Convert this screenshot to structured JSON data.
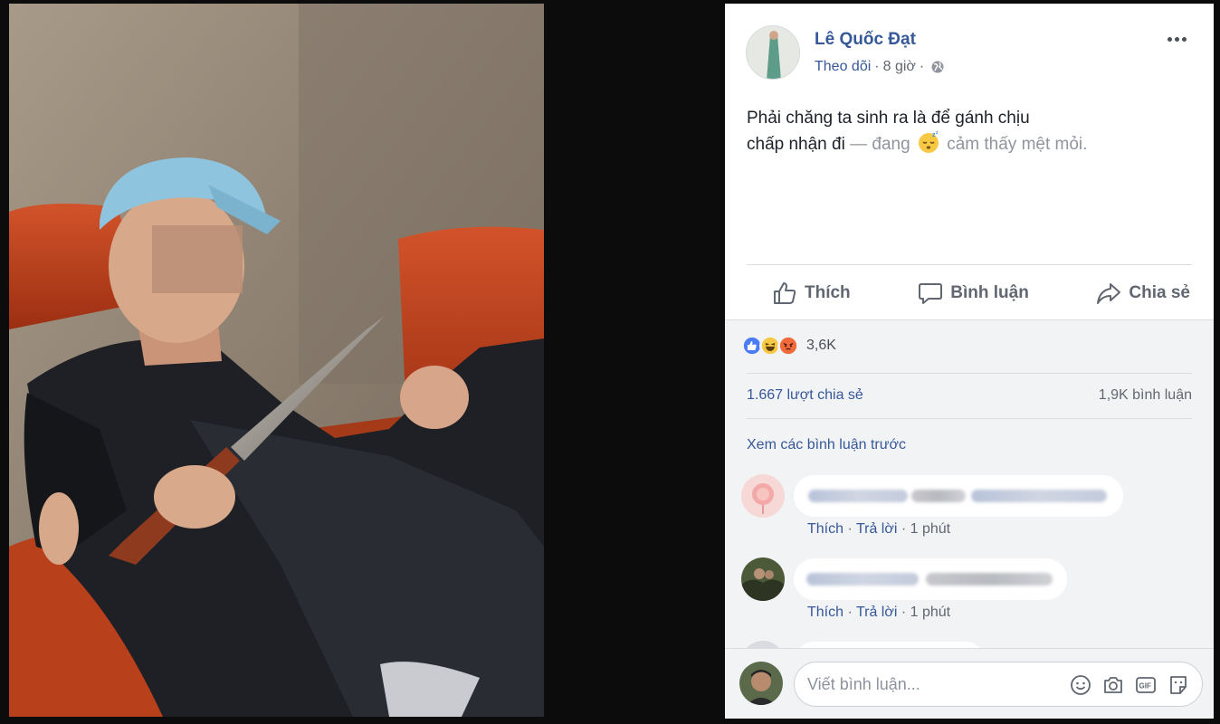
{
  "post": {
    "author": "Lê Quốc Đạt",
    "follow_label": "Theo dõi",
    "separator": "·",
    "time": "8 giờ",
    "text_line1": "Phải chăng ta sinh ra là để gánh chịu",
    "text_line2": "chấp nhận đi",
    "feeling_prefix": "— đang",
    "feeling": "cảm thấy mệt mỏi."
  },
  "actions": {
    "like": "Thích",
    "comment": "Bình luận",
    "share": "Chia sẻ"
  },
  "stats": {
    "reaction_count": "3,6K",
    "shares": "1.667 lượt chia sẻ",
    "comments": "1,9K bình luận",
    "view_previous": "Xem các bình luận trước"
  },
  "comments": [
    {
      "like": "Thích",
      "reply": "Trả lời",
      "sep": "·",
      "time": "1 phút"
    },
    {
      "like": "Thích",
      "reply": "Trả lời",
      "sep": "·",
      "time": "1 phút"
    }
  ],
  "composer": {
    "placeholder": "Viết bình luận..."
  },
  "colors": {
    "link": "#365899",
    "muted": "#616770",
    "feedback_bg": "#f2f3f5"
  },
  "icons": [
    "globe-icon",
    "more-icon",
    "like-icon",
    "comment-icon",
    "share-icon",
    "sleepy-emoji",
    "like-reaction-icon",
    "haha-reaction-icon",
    "angry-reaction-icon",
    "emoji-icon",
    "camera-icon",
    "gif-icon",
    "sticker-icon"
  ]
}
